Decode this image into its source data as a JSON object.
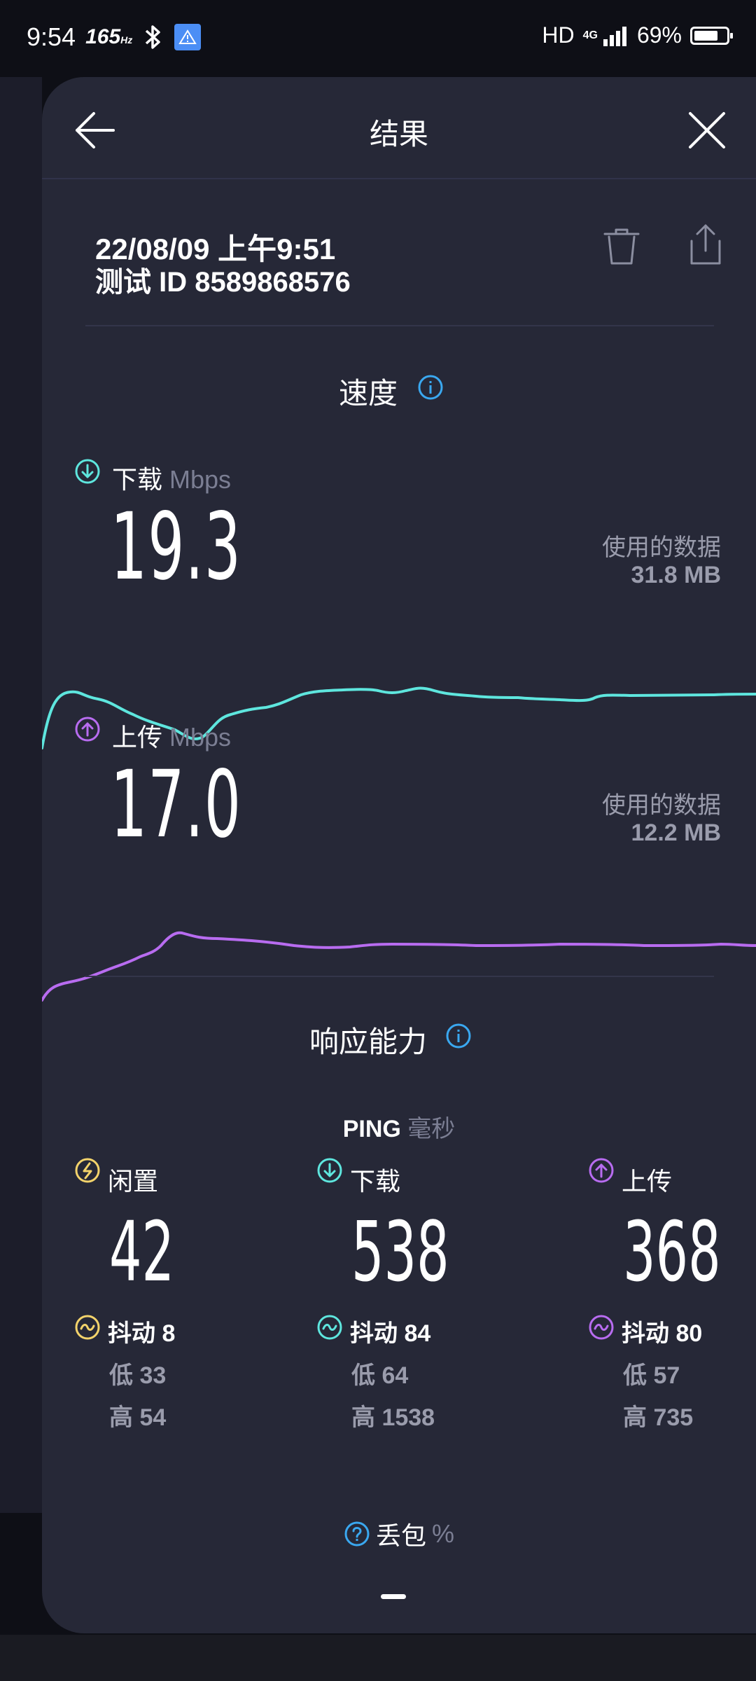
{
  "status_bar": {
    "time": "9:54",
    "refresh_rate": "165",
    "refresh_unit": "Hz",
    "hd": "HD",
    "network": "4G",
    "battery": "69%",
    "battery_level": 0.69
  },
  "header": {
    "title": "结果",
    "back_icon": "arrow-left-icon",
    "close_icon": "close-icon"
  },
  "meta": {
    "datetime": "22/08/09 上午9:51",
    "test_id": "测试 ID 8589868576",
    "trash_icon": "trash-icon",
    "share_icon": "share-icon"
  },
  "speed": {
    "title": "速度",
    "download": {
      "label": "下载",
      "unit": "Mbps",
      "value": "19.3",
      "data_used_label": "使用的数据",
      "data_used": "31.8 MB",
      "color": "#5ee6de"
    },
    "upload": {
      "label": "上传",
      "unit": "Mbps",
      "value": "17.0",
      "data_used_label": "使用的数据",
      "data_used": "12.2 MB",
      "color": "#b86cf0"
    }
  },
  "responsiveness": {
    "title": "响应能力",
    "ping_label": "PING",
    "ping_unit": "毫秒",
    "idle": {
      "label": "闲置",
      "value": "42",
      "jitter": "抖动 8",
      "low": "低 33",
      "high": "高 54",
      "color": "#f3d36b"
    },
    "download": {
      "label": "下载",
      "value": "538",
      "jitter": "抖动 84",
      "low": "低 64",
      "high": "高 1538",
      "color": "#5ee6de"
    },
    "upload": {
      "label": "上传",
      "value": "368",
      "jitter": "抖动 80",
      "low": "低 57",
      "high": "高 735",
      "color": "#b86cf0"
    }
  },
  "packet_loss": {
    "label": "丢包",
    "unit": "%"
  },
  "accent_info": "#3aa8f0"
}
